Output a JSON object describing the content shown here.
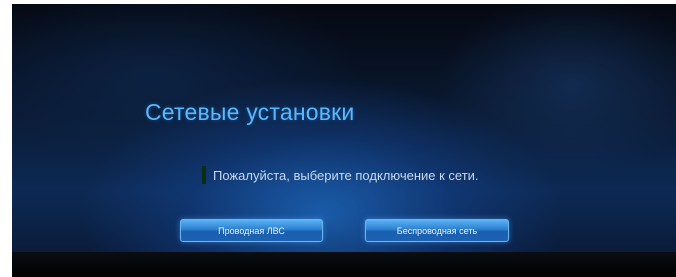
{
  "screen": {
    "title": "Сетевые установки",
    "message": "Пожалуйста, выберите подключение к сети."
  },
  "buttons": {
    "wired": "Проводная ЛВС",
    "wireless": "Беспроводная сеть"
  },
  "colors": {
    "title": "#57b9ff",
    "button": "#2b7fd0",
    "background": "#0a1a33"
  }
}
